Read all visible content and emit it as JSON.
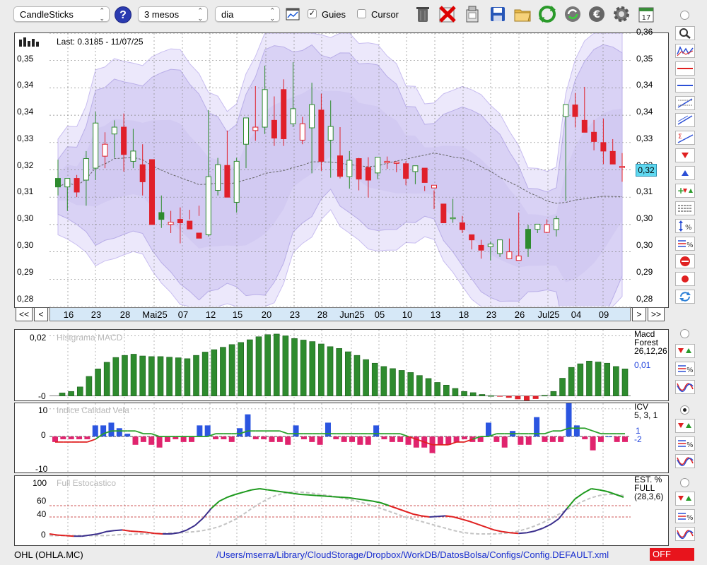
{
  "toolbar": {
    "chart_type": "CandleSticks",
    "help_label": "?",
    "period": "3 mesos",
    "interval": "dia",
    "guides_label": "Guies",
    "guides_checked": true,
    "cursor_label": "Cursor",
    "cursor_checked": false,
    "buttons": [
      "chart-settings-icon",
      "trash-icon",
      "delete-icon",
      "clear-icon",
      "save-icon",
      "open-folder-icon",
      "refresh-icon",
      "update-icon",
      "currency-icon",
      "gear-icon",
      "calendar-icon"
    ],
    "calendar_day": "17"
  },
  "main_chart": {
    "last_label": "Last: 0.3185 - 11/07/25",
    "y_labels_left": [
      "0,35",
      "0,34",
      "0,34",
      "0,33",
      "0,32",
      "0,31",
      "0,30",
      "0,30",
      "0,29",
      "0,28"
    ],
    "y_labels_right": [
      "0,36",
      "0,35",
      "0,34",
      "0,34",
      "0,33",
      "0,32",
      "0,31",
      "0,30",
      "0,30",
      "0,29",
      "0,28"
    ],
    "price_tag": "0,32",
    "dates": [
      "16",
      "23",
      "28",
      "Mai25",
      "07",
      "12",
      "15",
      "20",
      "23",
      "28",
      "Jun25",
      "05",
      "10",
      "13",
      "18",
      "23",
      "26",
      "Jul25",
      "04",
      "09"
    ],
    "nav_first": "<<",
    "nav_prev": "<",
    "nav_next": ">",
    "nav_last": ">>"
  },
  "macd_panel": {
    "title": "Histgrama MACD",
    "y_labels": [
      "0,02",
      "-0"
    ],
    "legend_name": "Macd",
    "legend_sub": "Forest",
    "legend_params": "26,12,26",
    "legend_value": "0,01"
  },
  "icv_panel": {
    "title": "Indice Calidad Vela",
    "y_labels": [
      "10",
      "0",
      "-10"
    ],
    "legend_name": "ICV",
    "legend_params": "5, 3, 1",
    "legend_value_1": "1",
    "legend_value_2": "-2"
  },
  "stoch_panel": {
    "title": "Full Estocastico",
    "y_labels": [
      "100",
      "60",
      "40",
      "0"
    ],
    "legend_name": "EST. %",
    "legend_sub": "FULL",
    "legend_params": "(28,3,6)"
  },
  "status": {
    "symbol": "OHL (OHLA.MC)",
    "path": "/Users/mserra/Library/CloudStorage/Dropbox/WorkDB/DatosBolsa/Configs/Config.DEFAULT.xml",
    "state": "OFF"
  },
  "right_tools": [
    "zoom-icon",
    "chart-view-icon",
    "red-line-icon",
    "blue-line-icon",
    "fibonacci-icon",
    "trend-lines-icon",
    "sum-lines-icon",
    "down-arrow-icon",
    "up-arrow-icon",
    "add-signal-icon",
    "grid-lines-icon",
    "percent-scale-icon",
    "percent-lines-icon",
    "stop-icon",
    "record-icon",
    "rotate-icon"
  ],
  "colors": {
    "up": "#2e8b2e",
    "down": "#e0202a",
    "band": "#d9d2f5",
    "accent": "#3a68c8"
  },
  "chart_data": [
    {
      "type": "candlestick",
      "series": [
        {
          "name": "OHL (OHLA.MC)"
        }
      ],
      "ylim": [
        0.2775,
        0.3575
      ],
      "x": [
        "16",
        "17",
        "18",
        "22",
        "23",
        "24",
        "25",
        "28",
        "29",
        "30",
        "Mai25",
        "05",
        "06",
        "07",
        "08",
        "09",
        "12",
        "13",
        "14",
        "15",
        "16",
        "19",
        "20",
        "21",
        "22",
        "23",
        "26",
        "27",
        "28",
        "29",
        "30",
        "Jun25",
        "03",
        "04",
        "05",
        "06",
        "09",
        "10",
        "11",
        "12",
        "13",
        "16",
        "17",
        "18",
        "19",
        "20",
        "23",
        "24",
        "25",
        "26",
        "27",
        "30",
        "Jul25",
        "02",
        "03",
        "04",
        "07",
        "08",
        "09",
        "10",
        "11"
      ],
      "open": [
        0.315,
        0.3125,
        0.315,
        0.3145,
        0.318,
        0.3215,
        0.328,
        0.33,
        0.32,
        0.319,
        0.3205,
        0.305,
        0.3015,
        0.303,
        0.3025,
        0.299,
        0.2985,
        0.3115,
        0.3188,
        0.308,
        0.325,
        0.329,
        0.33,
        0.332,
        0.341,
        0.331,
        0.3262,
        0.3298,
        0.335,
        0.3262,
        0.3216,
        0.3155,
        0.3208,
        0.3182,
        0.3166,
        0.3196,
        0.3194,
        0.3193,
        0.317,
        0.318,
        0.3122,
        0.3075,
        0.3035,
        0.302,
        0.2985,
        0.2954,
        0.295,
        0.293,
        0.2915,
        0.291,
        0.3001,
        0.3001,
        0.2992,
        0.3,
        0.3331,
        0.3365,
        0.332,
        0.3285,
        0.3255,
        0.3229,
        0.3185
      ],
      "high": [
        0.3205,
        0.315,
        0.316,
        0.323,
        0.3345,
        0.3285,
        0.332,
        0.334,
        0.3295,
        0.325,
        0.32,
        0.31,
        0.3055,
        0.3065,
        0.3058,
        0.307,
        0.335,
        0.321,
        0.329,
        0.321,
        0.3325,
        0.342,
        0.348,
        0.339,
        0.344,
        0.349,
        0.333,
        0.343,
        0.3398,
        0.3378,
        0.33,
        0.323,
        0.321,
        0.3212,
        0.321,
        0.3214,
        0.32,
        0.32,
        0.3185,
        0.3128,
        0.3115,
        0.3075,
        0.309,
        0.304,
        0.2985,
        0.297,
        0.2965,
        0.295,
        0.2974,
        0.305,
        0.3014,
        0.3001,
        0.303,
        0.304,
        0.3356,
        0.34,
        0.3418,
        0.3321,
        0.3325,
        0.3265,
        0.3224
      ],
      "low": [
        0.31,
        0.3055,
        0.3095,
        0.307,
        0.3145,
        0.318,
        0.321,
        0.317,
        0.318,
        0.31,
        0.303,
        0.3005,
        0.299,
        0.296,
        0.303,
        0.304,
        0.298,
        0.31,
        0.314,
        0.305,
        0.318,
        0.326,
        0.328,
        0.3245,
        0.3245,
        0.33,
        0.325,
        0.3165,
        0.3172,
        0.3152,
        0.315,
        0.312,
        0.3115,
        0.3094,
        0.3148,
        0.3178,
        0.3168,
        0.313,
        0.3133,
        0.3113,
        0.306,
        0.306,
        0.302,
        0.299,
        0.2942,
        0.2915,
        0.291,
        0.292,
        0.292,
        0.2915,
        0.292,
        0.299,
        0.299,
        0.298,
        0.3084,
        0.3299,
        0.3314,
        0.3232,
        0.3192,
        0.3212,
        0.314
      ],
      "close": [
        0.3125,
        0.315,
        0.311,
        0.3208,
        0.3312,
        0.325,
        0.33,
        0.322,
        0.323,
        0.314,
        0.3015,
        0.303,
        0.3022,
        0.302,
        0.3002,
        0.2975,
        0.3155,
        0.319,
        0.3095,
        0.32,
        0.3327,
        0.33,
        0.341,
        0.3268,
        0.3266,
        0.3354,
        0.331,
        0.3366,
        0.32,
        0.3302,
        0.3156,
        0.3203,
        0.3148,
        0.3145,
        0.3212,
        0.32,
        0.3198,
        0.315,
        0.3187,
        0.3138,
        0.313,
        0.302,
        0.3035,
        0.3,
        0.297,
        0.294,
        0.2958,
        0.297,
        0.2935,
        0.2923,
        0.2945,
        0.3016,
        0.3015,
        0.3032,
        0.3366,
        0.3331,
        0.3285,
        0.3258,
        0.323,
        0.3192,
        0.3185
      ]
    },
    {
      "type": "bar",
      "title": "Histgrama MACD",
      "ylim": [
        -0.0015,
        0.022
      ],
      "values": [
        0.001,
        0.0015,
        0.003,
        0.0065,
        0.009,
        0.0112,
        0.0128,
        0.0135,
        0.0139,
        0.0133,
        0.0131,
        0.0131,
        0.0129,
        0.0127,
        0.0124,
        0.0135,
        0.0146,
        0.0154,
        0.0162,
        0.0171,
        0.0178,
        0.0187,
        0.0197,
        0.0204,
        0.0206,
        0.02,
        0.0191,
        0.0186,
        0.0181,
        0.0173,
        0.0164,
        0.0158,
        0.0147,
        0.0135,
        0.0121,
        0.0109,
        0.0098,
        0.0091,
        0.0085,
        0.0078,
        0.0068,
        0.0058,
        0.0045,
        0.0036,
        0.0025,
        0.0015,
        0.0011,
        0.0005,
        0.0001,
        -0.0002,
        -0.0006,
        -0.0011,
        -0.0018,
        -0.001,
        0.0002,
        0.0015,
        0.0059,
        0.0095,
        0.0107,
        0.0116,
        0.0113,
        0.0109,
        0.0098,
        0.009
      ]
    },
    {
      "type": "bar",
      "title": "Indice Calidad Vela",
      "ylim": [
        -13,
        12
      ],
      "values": [
        -2,
        -1,
        -1,
        -1,
        -1,
        4,
        4,
        5,
        3,
        1,
        -3,
        -2,
        -3,
        -4,
        -2,
        -1,
        -2,
        -2,
        4,
        4,
        -1,
        -1,
        -2,
        3,
        8,
        -1,
        -1,
        -2,
        -2,
        -3,
        4,
        -1,
        -2,
        -3,
        5,
        -1,
        -2,
        -2,
        -3,
        -3,
        4,
        -1,
        -2,
        -2,
        -3,
        -4,
        -4,
        -6,
        -3,
        -3,
        -2,
        -1,
        -2,
        -2,
        5,
        -2,
        -4,
        2,
        -3,
        -3,
        7,
        -2,
        -2,
        -2,
        12,
        4,
        -1,
        -5,
        -2,
        0,
        -2,
        -2
      ],
      "series": [
        {
          "values": [
            -2,
            -2,
            -2,
            -2,
            -2,
            -1,
            1,
            2,
            2,
            2,
            2,
            1,
            1,
            0,
            0,
            0,
            0,
            0,
            0,
            0,
            1,
            1,
            1,
            1,
            2,
            2,
            2,
            2,
            2,
            1,
            1,
            1,
            1,
            1,
            1,
            1,
            1,
            1,
            1,
            1,
            1,
            1,
            1,
            1,
            0,
            -1,
            -2,
            -3,
            -3,
            -3,
            -2,
            -2,
            -1,
            0,
            0,
            1,
            1,
            1,
            1,
            1,
            1,
            1,
            2,
            2,
            3,
            3,
            3,
            2,
            1,
            1,
            1,
            1
          ]
        }
      ]
    },
    {
      "type": "line",
      "title": "Full Estocastico",
      "ylim": [
        0,
        100
      ],
      "series": [
        {
          "values": [
            10,
            8,
            7,
            6,
            6,
            8,
            10,
            14,
            16,
            17,
            15,
            14,
            13,
            11,
            10,
            10,
            12,
            17,
            25,
            38,
            55,
            68,
            75,
            80,
            84,
            88,
            90,
            88,
            86,
            84,
            82,
            80,
            79,
            78,
            77,
            76,
            75,
            74,
            72,
            70,
            68,
            65,
            60,
            55,
            50,
            45,
            42,
            40,
            41,
            42,
            40,
            36,
            32,
            27,
            22,
            17,
            14,
            12,
            11,
            12,
            15,
            20,
            27,
            37,
            55,
            72,
            82,
            90,
            88,
            85,
            80,
            75
          ]
        },
        {
          "values": [
            7,
            7,
            7,
            7,
            7,
            7,
            7,
            7,
            8,
            9,
            9,
            10,
            10,
            11,
            11,
            12,
            12,
            13,
            14,
            16,
            19,
            23,
            29,
            36,
            45,
            55,
            64,
            72,
            78,
            82,
            84,
            84,
            83,
            81,
            79,
            77,
            74,
            71,
            68,
            64,
            60,
            55,
            50,
            45,
            40,
            36,
            32,
            28,
            24,
            20,
            16,
            13,
            11,
            10,
            10,
            10,
            11,
            12,
            15,
            19,
            24,
            30,
            37,
            45,
            53,
            61,
            68,
            74,
            78,
            80,
            80,
            78
          ]
        }
      ],
      "reference_lines": [
        60,
        40
      ]
    }
  ]
}
